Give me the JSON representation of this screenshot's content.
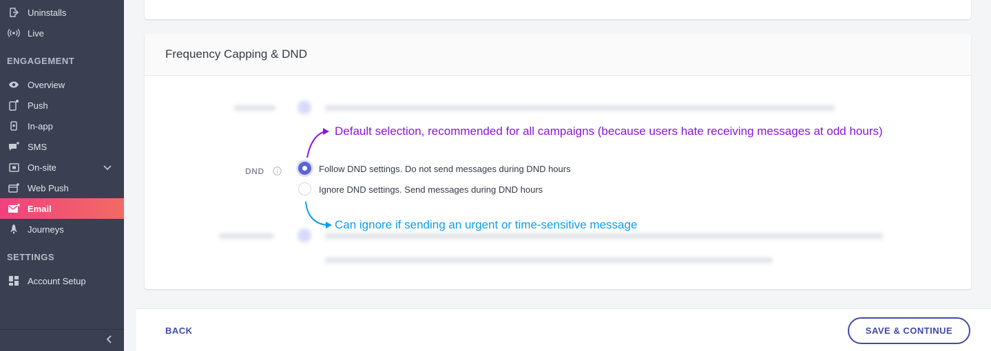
{
  "sidebar": {
    "items_top": [
      {
        "label": "Uninstalls",
        "icon": "uninstall-icon"
      },
      {
        "label": "Live",
        "icon": "live-broadcast-icon"
      }
    ],
    "engagement_title": "ENGAGEMENT",
    "engagement_items": [
      {
        "label": "Overview",
        "icon": "eye-icon"
      },
      {
        "label": "Push",
        "icon": "phone-notification-icon"
      },
      {
        "label": "In-app",
        "icon": "phone-icon"
      },
      {
        "label": "SMS",
        "icon": "sms-icon"
      },
      {
        "label": "On-site",
        "icon": "on-site-icon"
      },
      {
        "label": "Web Push",
        "icon": "browser-icon"
      },
      {
        "label": "Email",
        "icon": "mail-icon",
        "active": true
      },
      {
        "label": "Journeys",
        "icon": "rocket-icon"
      }
    ],
    "settings_title": "SETTINGS",
    "settings_items": [
      {
        "label": "Account Setup",
        "icon": "grid-icon"
      }
    ],
    "active_gradient": [
      "#f0417f",
      "#f26b63"
    ]
  },
  "card": {
    "title": "Frequency Capping & DND"
  },
  "dnd": {
    "label": "DND",
    "options": [
      {
        "label": "Follow DND settings. Do not send messages during DND hours",
        "selected": true
      },
      {
        "label": "Ignore DND settings. Send messages during DND hours",
        "selected": false
      }
    ]
  },
  "annotations": {
    "default_note": "Default selection, recommended for all campaigns (because users hate receiving messages at odd hours)",
    "ignore_note": "Can ignore if sending an urgent or time-sensitive message",
    "colors": {
      "purple": "#8a14e0",
      "blue": "#0a9ef0"
    }
  },
  "footer": {
    "back_label": "BACK",
    "save_label": "SAVE & CONTINUE",
    "accent": "#3f4aa8"
  }
}
